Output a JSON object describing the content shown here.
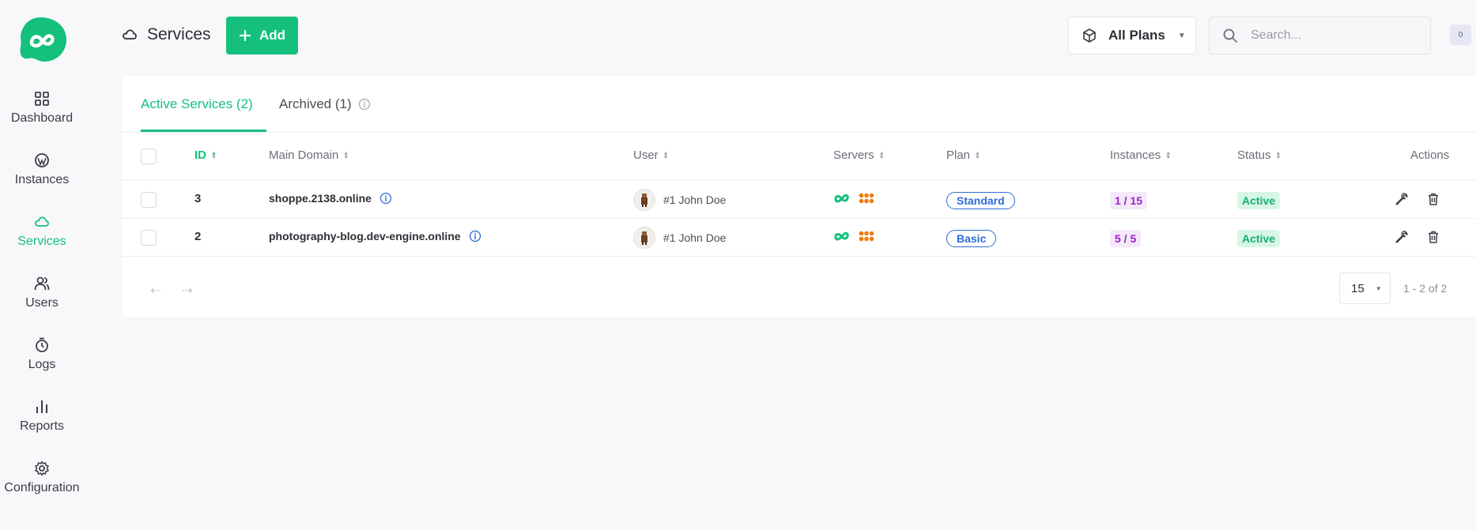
{
  "nav": [
    {
      "label": "Dashboard",
      "icon": "grid-icon"
    },
    {
      "label": "Instances",
      "icon": "wordpress-icon"
    },
    {
      "label": "Services",
      "icon": "cloud-icon",
      "active": true
    },
    {
      "label": "Users",
      "icon": "users-icon"
    },
    {
      "label": "Logs",
      "icon": "stopwatch-icon"
    },
    {
      "label": "Reports",
      "icon": "bar-chart-icon"
    },
    {
      "label": "Configuration",
      "icon": "gear-icon"
    }
  ],
  "header": {
    "title": "Services",
    "add_label": "Add",
    "plans_label": "All Plans",
    "search_placeholder": "Search...",
    "notification_count": "0"
  },
  "tabs": [
    {
      "label": "Active Services (2)",
      "active": true
    },
    {
      "label": "Archived (1)"
    }
  ],
  "table": {
    "columns": [
      "ID",
      "Main Domain",
      "User",
      "Servers",
      "Plan",
      "Instances",
      "Status",
      "Actions"
    ],
    "rows": [
      {
        "id": "3",
        "domain": "shoppe.2138.online",
        "user": "#1 John Doe",
        "plan": "Standard",
        "instances": "1 / 15",
        "status": "Active"
      },
      {
        "id": "2",
        "domain": "photography-blog.dev-engine.online",
        "user": "#1 John Doe",
        "plan": "Basic",
        "instances": "5 / 5",
        "status": "Active"
      }
    ]
  },
  "pagination": {
    "per_page": "15",
    "range": "1 - 2 of 2"
  },
  "colors": {
    "accent": "#14c07c",
    "plan_badge": "#2d6cd7",
    "instances_badge": "#9a23c6",
    "server_orange": "#f07b14"
  }
}
